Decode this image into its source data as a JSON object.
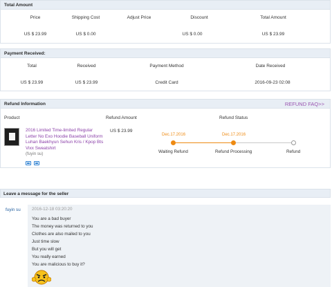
{
  "total": {
    "title": "Total Amount",
    "headers": [
      "Price",
      "Shipping Cost",
      "Adjust Price",
      "Discount",
      "Total Amount"
    ],
    "values": [
      "US $ 23.99",
      "US $ 0.00",
      "",
      "US $ 0.00",
      "US $ 23.99"
    ]
  },
  "payment": {
    "title": "Payment Received:",
    "headers": [
      "Total",
      "Received",
      "Payment Method",
      "Date Received"
    ],
    "values": [
      "US $ 23.99",
      "US $ 23.99",
      "Credit Card",
      "2016-09-23 02:08"
    ]
  },
  "refund": {
    "title": "Refund Information",
    "faq": "REFUND FAQ>>",
    "col_product": "Product",
    "col_amount": "Refund Amount",
    "col_status": "Refund Status",
    "product_title": "2016 Limited Time-limited Regular Letter No Exo Hoodie Baseball Uniform Luhan Baekhyun Sehun Kris / Kpop Bts Vixx Sweatshirt",
    "buyer": "(fuyin su)",
    "amount": "US $ 23.99",
    "steps": [
      {
        "date": "Dec.17.2016",
        "label": "Waiting Refund",
        "state": "done"
      },
      {
        "date": "Dec.17.2016",
        "label": "Refund Processing",
        "state": "done"
      },
      {
        "date": "",
        "label": "Refund",
        "state": "todo"
      }
    ],
    "accent": "#ee8a12"
  },
  "message": {
    "title": "Leave a message for the seller",
    "author": "fuyin su",
    "time": "2016-12-18 03:20:20",
    "lines": [
      "You are a bad buyer",
      "The money was returned to you",
      "Clothes are also mailed to you",
      "Just time slow",
      "But you will get",
      "You really earned",
      "You are malicious to buy it?"
    ]
  }
}
